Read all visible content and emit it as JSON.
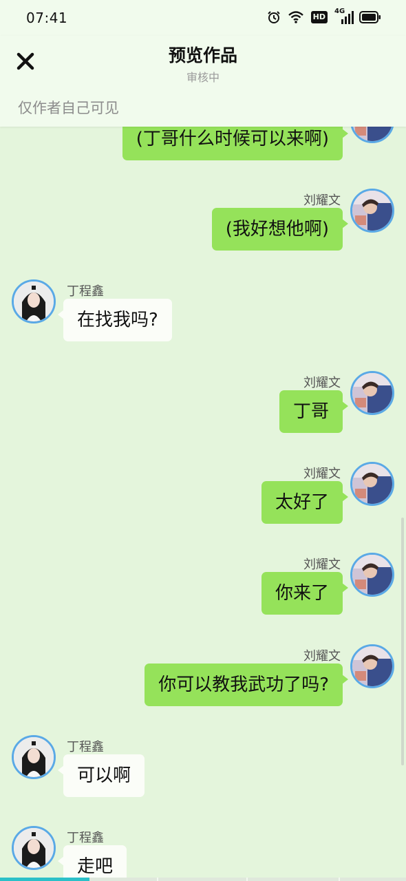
{
  "status_bar": {
    "time": "07:41",
    "network": "4G",
    "hd": "HD"
  },
  "header": {
    "title": "预览作品",
    "subtitle": "审核中",
    "visibility_note": "仅作者自己可见"
  },
  "messages": [
    {
      "side": "right",
      "name": "",
      "text": "(丁哥什么时候可以来啊)"
    },
    {
      "side": "right",
      "name": "刘耀文",
      "text": "(我好想他啊)"
    },
    {
      "side": "left",
      "name": "丁程鑫",
      "text": "在找我吗?"
    },
    {
      "side": "right",
      "name": "刘耀文",
      "text": "丁哥"
    },
    {
      "side": "right",
      "name": "刘耀文",
      "text": "太好了"
    },
    {
      "side": "right",
      "name": "刘耀文",
      "text": "你来了"
    },
    {
      "side": "right",
      "name": "刘耀文",
      "text": "你可以教我武功了吗?"
    },
    {
      "side": "left",
      "name": "丁程鑫",
      "text": "可以啊"
    },
    {
      "side": "left",
      "name": "丁程鑫",
      "text": "走吧"
    }
  ],
  "progress": {
    "fraction": 0.22
  },
  "colors": {
    "accent": "#2bc0c8",
    "sent_bubble": "#95e25a",
    "received_bubble": "#fbfdf8",
    "avatar_ring": "#5aa9e6"
  }
}
